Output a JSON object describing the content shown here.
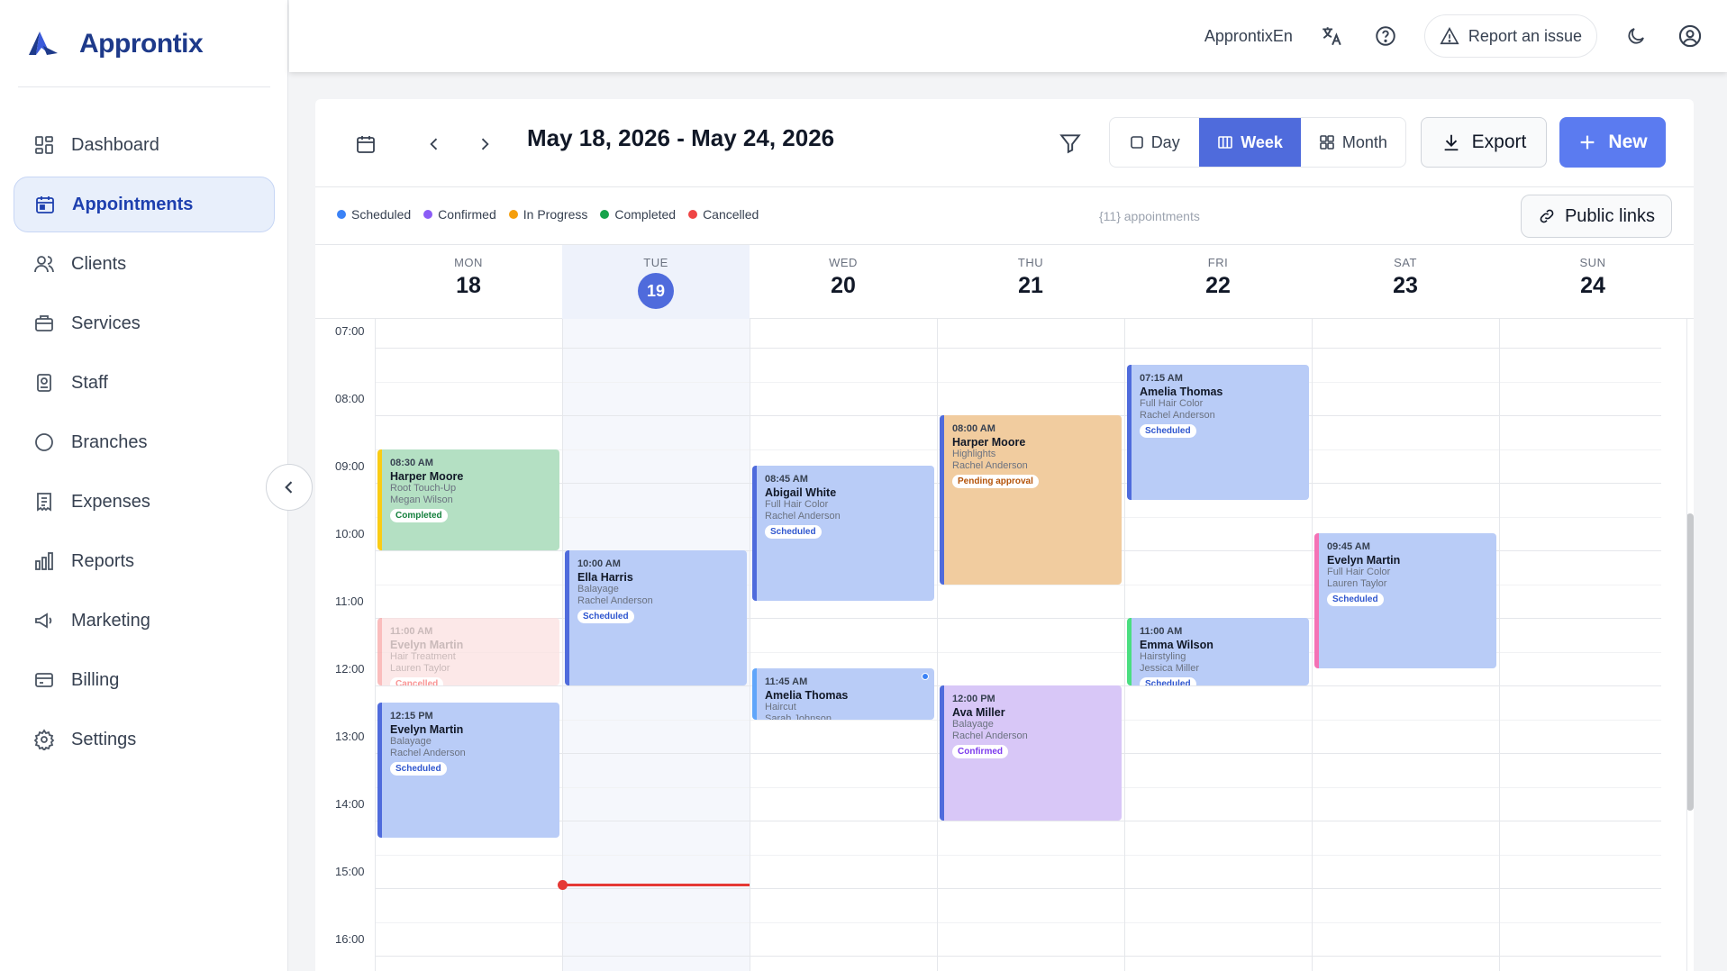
{
  "app": {
    "name": "Approntix"
  },
  "sidebar": {
    "items": [
      {
        "label": "Dashboard",
        "icon": "dashboard-icon",
        "active": false
      },
      {
        "label": "Appointments",
        "icon": "calendar-icon",
        "active": true
      },
      {
        "label": "Clients",
        "icon": "users-icon",
        "active": false
      },
      {
        "label": "Services",
        "icon": "briefcase-icon",
        "active": false
      },
      {
        "label": "Staff",
        "icon": "badge-icon",
        "active": false
      },
      {
        "label": "Branches",
        "icon": "circle-icon",
        "active": false
      },
      {
        "label": "Expenses",
        "icon": "receipt-icon",
        "active": false
      },
      {
        "label": "Reports",
        "icon": "bar-chart-icon",
        "active": false
      },
      {
        "label": "Marketing",
        "icon": "megaphone-icon",
        "active": false
      },
      {
        "label": "Billing",
        "icon": "credit-card-icon",
        "active": false
      },
      {
        "label": "Settings",
        "icon": "gear-icon",
        "active": false
      }
    ]
  },
  "topbar": {
    "org": "ApprontixEn",
    "report_label": "Report an issue"
  },
  "toolbar": {
    "date_range": "May 18, 2026 - May 24, 2026",
    "views": [
      {
        "label": "Day",
        "active": false
      },
      {
        "label": "Week",
        "active": true
      },
      {
        "label": "Month",
        "active": false
      }
    ],
    "export_label": "Export",
    "new_label": "New"
  },
  "legend": {
    "items": [
      {
        "label": "Scheduled",
        "color": "#3b82f6"
      },
      {
        "label": "Confirmed",
        "color": "#8b5cf6"
      },
      {
        "label": "In Progress",
        "color": "#f59e0b"
      },
      {
        "label": "Completed",
        "color": "#16a34a"
      },
      {
        "label": "Cancelled",
        "color": "#ef4444"
      }
    ],
    "count_text": "{11} appointments",
    "public_links_label": "Public links"
  },
  "week": {
    "days": [
      {
        "dow": "MON",
        "num": "18",
        "today": false
      },
      {
        "dow": "TUE",
        "num": "19",
        "today": true
      },
      {
        "dow": "WED",
        "num": "20",
        "today": false
      },
      {
        "dow": "THU",
        "num": "21",
        "today": false
      },
      {
        "dow": "FRI",
        "num": "22",
        "today": false
      },
      {
        "dow": "SAT",
        "num": "23",
        "today": false
      },
      {
        "dow": "SUN",
        "num": "24",
        "today": false
      }
    ],
    "hours": [
      "07:00",
      "08:00",
      "09:00",
      "10:00",
      "11:00",
      "12:00",
      "13:00",
      "14:00",
      "15:00",
      "16:00"
    ]
  },
  "events": [
    {
      "day": 0,
      "time": "08:30 AM",
      "client": "Harper Moore",
      "service": "Root Touch-Up",
      "staff": "Megan Wilson",
      "status": "Completed",
      "start": 8.5,
      "end": 10.0,
      "style": "completed"
    },
    {
      "day": 0,
      "time": "11:00 AM",
      "client": "Evelyn Martin",
      "service": "Hair Treatment",
      "staff": "Lauren Taylor",
      "status": "Cancelled",
      "start": 11.0,
      "end": 12.0,
      "style": "cancelled"
    },
    {
      "day": 0,
      "time": "12:15 PM",
      "client": "Evelyn Martin",
      "service": "Balayage",
      "staff": "Rachel Anderson",
      "status": "Scheduled",
      "start": 12.25,
      "end": 14.25,
      "style": "scheduled"
    },
    {
      "day": 1,
      "time": "10:00 AM",
      "client": "Ella Harris",
      "service": "Balayage",
      "staff": "Rachel Anderson",
      "status": "Scheduled",
      "start": 10.0,
      "end": 12.0,
      "style": "scheduled"
    },
    {
      "day": 2,
      "time": "08:45 AM",
      "client": "Abigail White",
      "service": "Full Hair Color",
      "staff": "Rachel Anderson",
      "status": "Scheduled",
      "start": 8.75,
      "end": 10.75,
      "style": "scheduled"
    },
    {
      "day": 2,
      "time": "11:45 AM",
      "client": "Amelia Thomas",
      "service": "Haircut",
      "staff": "Sarah Johnson",
      "status": "",
      "start": 11.75,
      "end": 12.5,
      "style": "inprog"
    },
    {
      "day": 3,
      "time": "08:00 AM",
      "client": "Harper Moore",
      "service": "Highlights",
      "staff": "Rachel Anderson",
      "status": "Pending approval",
      "start": 8.0,
      "end": 10.5,
      "style": "pending"
    },
    {
      "day": 3,
      "time": "12:00 PM",
      "client": "Ava Miller",
      "service": "Balayage",
      "staff": "Rachel Anderson",
      "status": "Confirmed",
      "start": 12.0,
      "end": 14.0,
      "style": "confirmed"
    },
    {
      "day": 4,
      "time": "07:15 AM",
      "client": "Amelia Thomas",
      "service": "Full Hair Color",
      "staff": "Rachel Anderson",
      "status": "Scheduled",
      "start": 7.25,
      "end": 9.25,
      "style": "scheduled"
    },
    {
      "day": 4,
      "time": "11:00 AM",
      "client": "Emma Wilson",
      "service": "Hairstyling",
      "staff": "Jessica Miller",
      "status": "Scheduled",
      "start": 11.0,
      "end": 12.0,
      "style": "scheduled green"
    },
    {
      "day": 5,
      "time": "09:45 AM",
      "client": "Evelyn Martin",
      "service": "Full Hair Color",
      "staff": "Lauren Taylor",
      "status": "Scheduled",
      "start": 9.75,
      "end": 11.75,
      "style": "scheduled pink"
    }
  ],
  "now_time": 15.2
}
